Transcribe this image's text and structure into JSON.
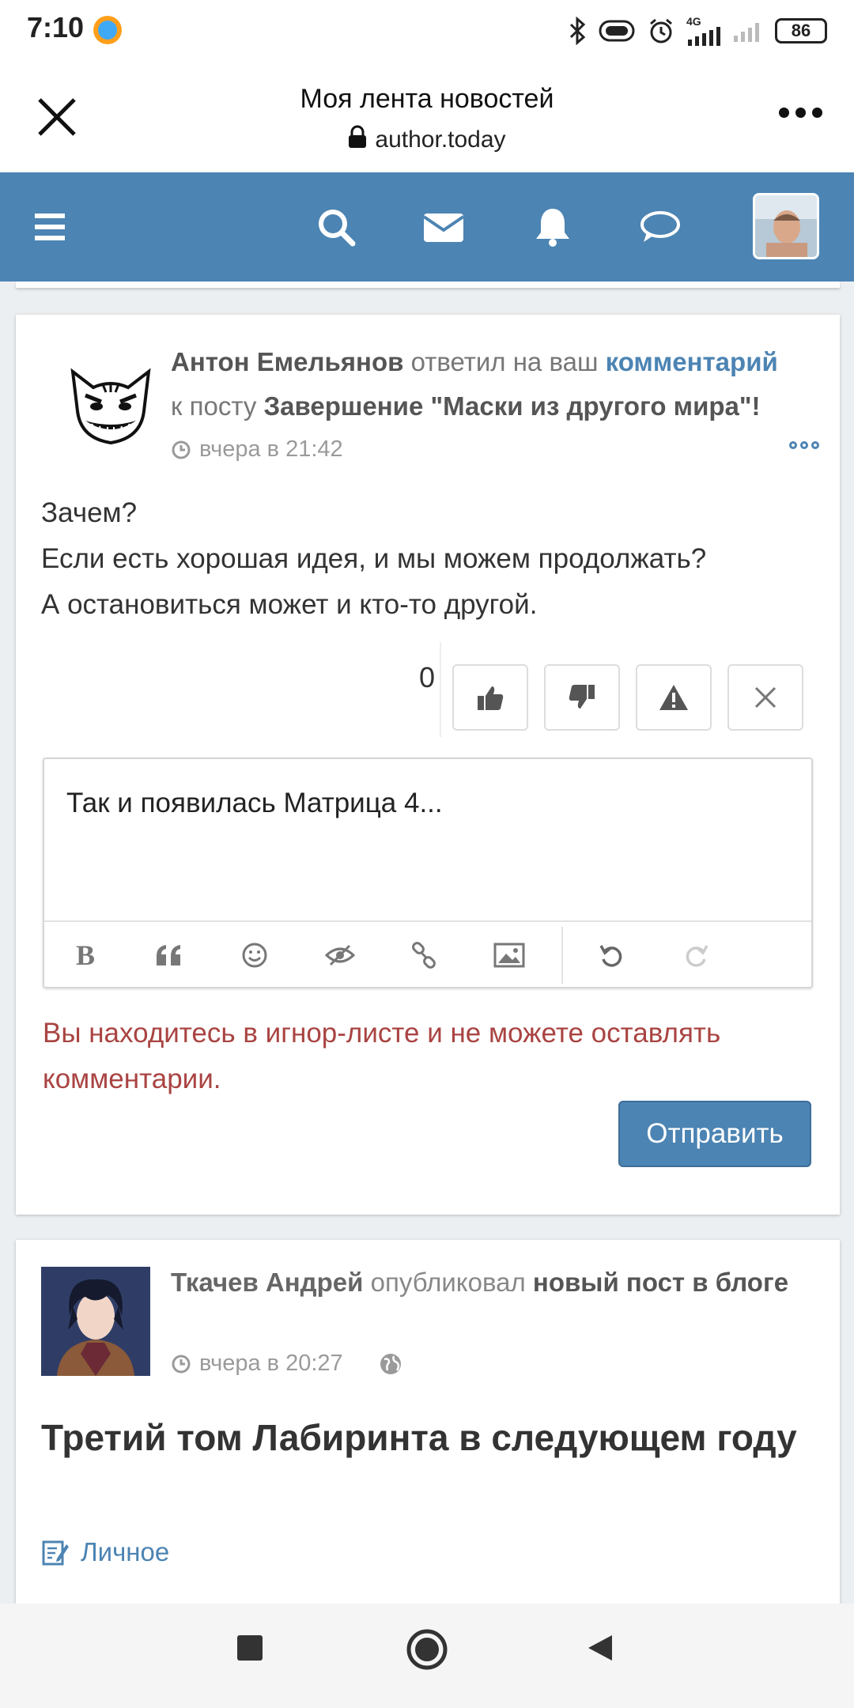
{
  "status_bar": {
    "time": "7:10",
    "network": "4G",
    "battery": "86",
    "icons": [
      "app-notification-icon",
      "bluetooth-icon",
      "vibrate-icon",
      "alarm-icon",
      "signal-icon",
      "signal-2-icon"
    ]
  },
  "browser": {
    "title": "Моя лента новостей",
    "url": "author.today",
    "icons": [
      "close-icon",
      "lock-icon",
      "overflow-menu-icon"
    ]
  },
  "site_nav": {
    "icons": [
      "menu-icon",
      "search-icon",
      "mail-icon",
      "bell-icon",
      "chat-icon",
      "user-avatar"
    ],
    "accent": "#4c84b3"
  },
  "notification1": {
    "author": "Антон Емельянов",
    "action": " ответил на ваш ",
    "link": "комментарий",
    "to_post": " к посту ",
    "post_title": "Завершение \"Маски из другого мира\"!",
    "time": "вчера в 21:42",
    "body": [
      "Зачем?",
      "Если есть хорошая идея, и мы можем продолжать?",
      "А остановиться может и кто-то другой."
    ],
    "vote_count": "0",
    "actions": [
      "thumbs-up-icon",
      "thumbs-down-icon",
      "warning-icon",
      "close-icon"
    ]
  },
  "editor": {
    "text": "Так и появилась Матрица 4...",
    "toolbar": [
      "bold-icon",
      "quote-icon",
      "smile-icon",
      "spoiler-icon",
      "link-icon",
      "image-icon",
      "undo-icon",
      "redo-icon"
    ]
  },
  "error_message": "Вы находитесь в игнор-листе и не можете оставлять комментарии.",
  "error_color": "#a94442",
  "send_label": "Отправить",
  "notification2": {
    "author": "Ткачев Андрей",
    "action": " опубликовал ",
    "post_type": "новый пост в блоге",
    "time": "вчера в 20:27",
    "title": "Третий том Лабиринта в следующем году",
    "category": "Личное"
  },
  "system_nav": [
    "recents-icon",
    "home-icon",
    "back-icon"
  ]
}
